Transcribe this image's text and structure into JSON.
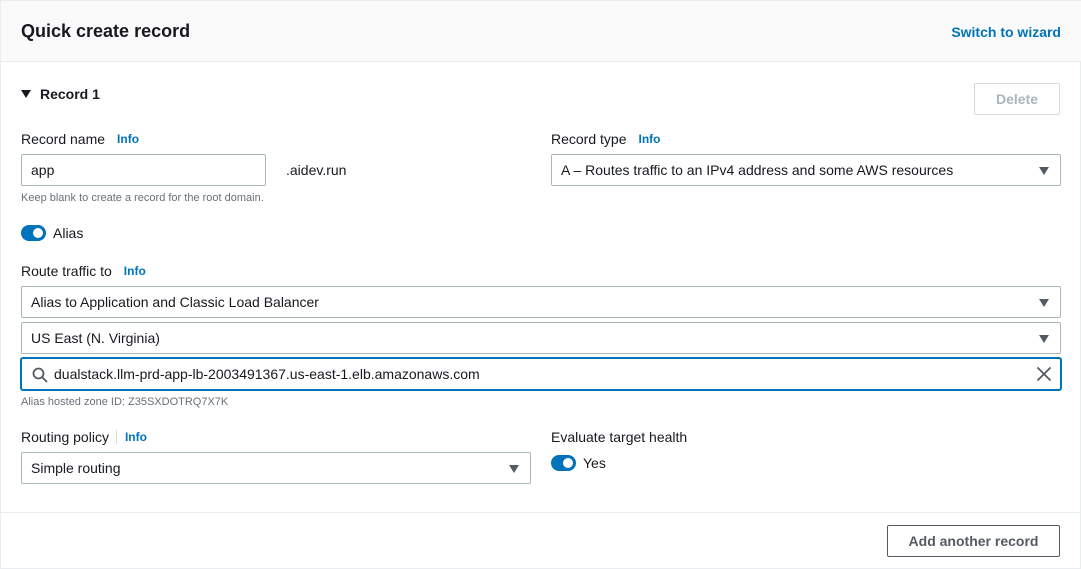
{
  "header": {
    "title": "Quick create record",
    "switch_link": "Switch to wizard"
  },
  "record": {
    "section_label": "Record 1",
    "delete_label": "Delete",
    "record_name": {
      "label": "Record name",
      "info": "Info",
      "value": "app",
      "suffix": ".aidev.run",
      "hint": "Keep blank to create a record for the root domain."
    },
    "record_type": {
      "label": "Record type",
      "info": "Info",
      "value": "A – Routes traffic to an IPv4 address and some AWS resources"
    },
    "alias": {
      "label": "Alias",
      "enabled": true
    },
    "route_traffic": {
      "label": "Route traffic to",
      "info": "Info",
      "endpoint": "Alias to Application and Classic Load Balancer",
      "region": "US East (N. Virginia)",
      "load_balancer": "dualstack.llm-prd-app-lb-2003491367.us-east-1.elb.amazonaws.com",
      "hosted_zone_hint": "Alias hosted zone ID: Z35SXDOTRQ7X7K"
    },
    "routing_policy": {
      "label": "Routing policy",
      "info": "Info",
      "value": "Simple routing"
    },
    "evaluate_health": {
      "label": "Evaluate target health",
      "toggle_label": "Yes",
      "enabled": true
    }
  },
  "footer": {
    "add_label": "Add another record"
  },
  "colors": {
    "accent": "#0073bb",
    "text": "#16191f",
    "muted": "#687078"
  }
}
